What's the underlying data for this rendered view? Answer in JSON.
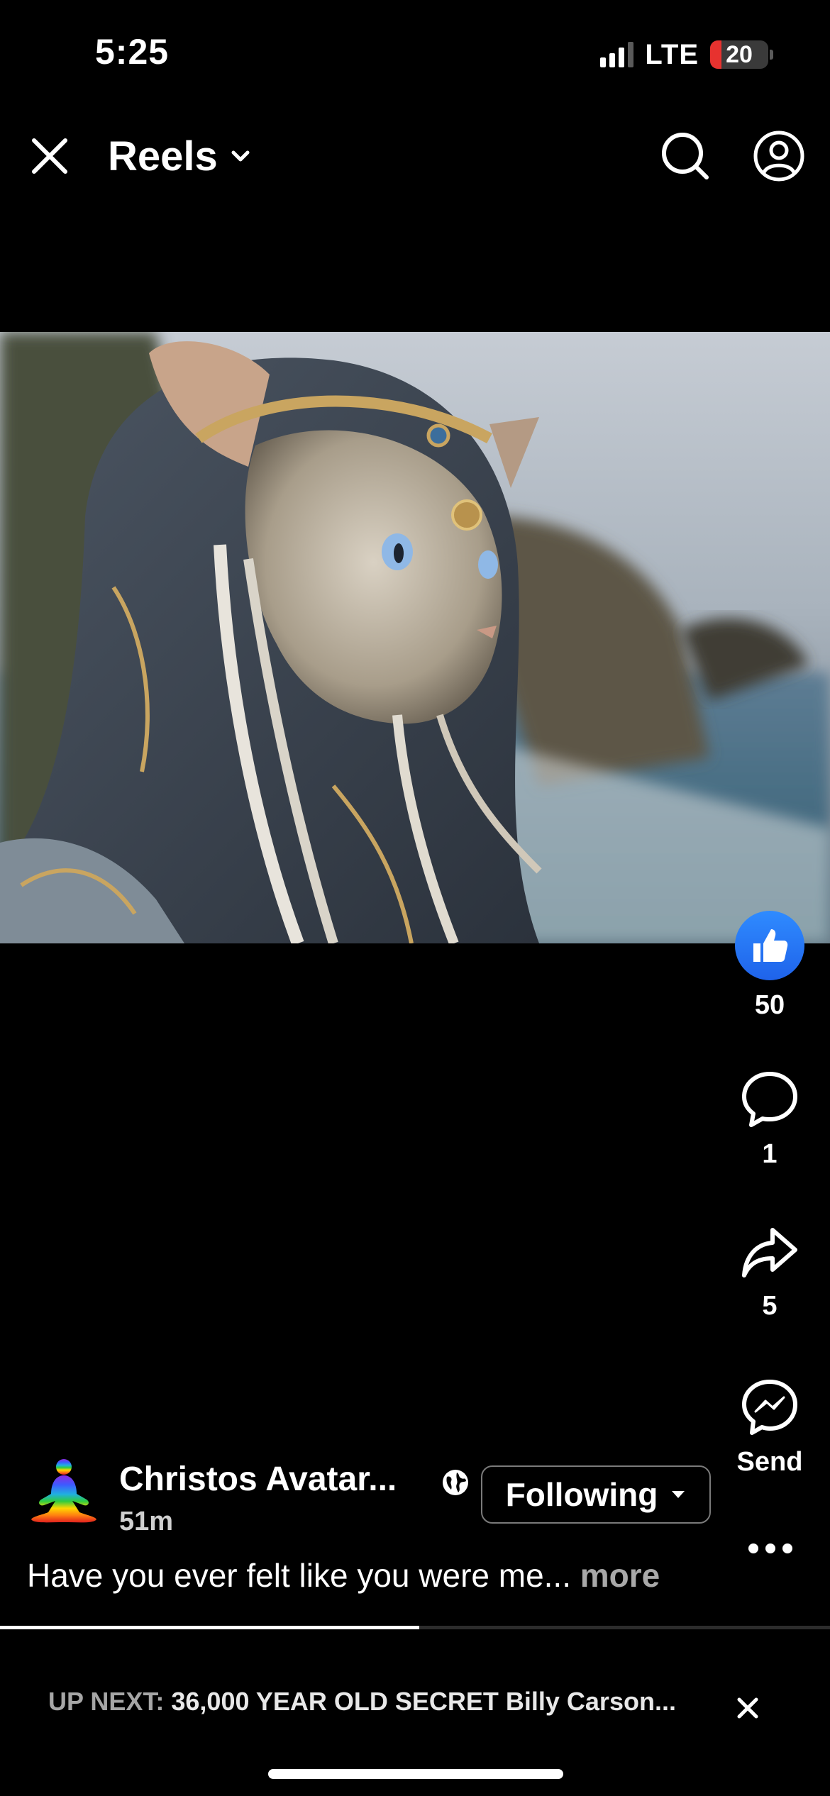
{
  "status_bar": {
    "time": "5:25",
    "network": "LTE",
    "battery_percent": "20",
    "battery_level": 0.2,
    "signal_bars_active": 3
  },
  "header": {
    "title": "Reels",
    "icons": [
      "close-icon",
      "chevron-down-icon",
      "search-icon",
      "profile-icon"
    ]
  },
  "video": {
    "accent_colors": [
      "#3d4a58",
      "#c9a560",
      "#8fb8e6"
    ]
  },
  "actions": {
    "like_count": "50",
    "comment_count": "1",
    "share_count": "5",
    "send_label": "Send",
    "like_color": "#2a78f5"
  },
  "post": {
    "author": "Christos Avatar...",
    "time_ago": "51m",
    "follow_label": "Following",
    "caption": "Have you ever felt like you were me...",
    "more_label": "more",
    "audience_icon": "globe-icon"
  },
  "playback": {
    "progress": 0.505
  },
  "up_next": {
    "label": "UP NEXT:",
    "title": "36,000 YEAR OLD SECRET Billy Carson..."
  }
}
